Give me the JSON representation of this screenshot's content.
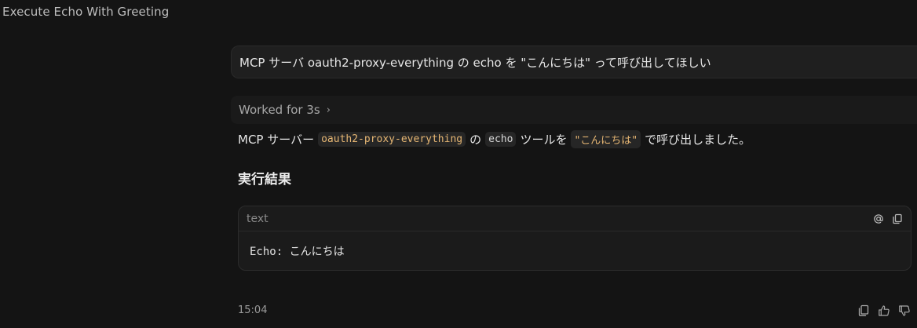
{
  "window": {
    "title": "Execute Echo With Greeting"
  },
  "user_message": {
    "text": "MCP サーバ oauth2-proxy-everything の echo を \"こんにちは\" って呼び出してほしい"
  },
  "worked": {
    "label": "Worked for 3s",
    "chevron": "›"
  },
  "response": {
    "prefix": "MCP サーバー",
    "server_code": "oauth2-proxy-everything",
    "particle_no": "の",
    "tool_code": "echo",
    "tool_suffix": "ツールを",
    "arg_code": "\"こんにちは\"",
    "suffix": "で呼び出しました。"
  },
  "result": {
    "heading": "実行結果",
    "code_lang": "text",
    "code_content": "Echo: こんにちは"
  },
  "footer": {
    "timestamp": "15:04"
  },
  "icons": {
    "mention": "at-sign-icon",
    "copy_code": "copy-icon",
    "copy_message": "copy-icon",
    "thumbs_up": "thumbs-up-icon",
    "thumbs_down": "thumbs-down-icon"
  },
  "colors": {
    "background": "#141414",
    "inline_code_text": "#e6b673"
  }
}
